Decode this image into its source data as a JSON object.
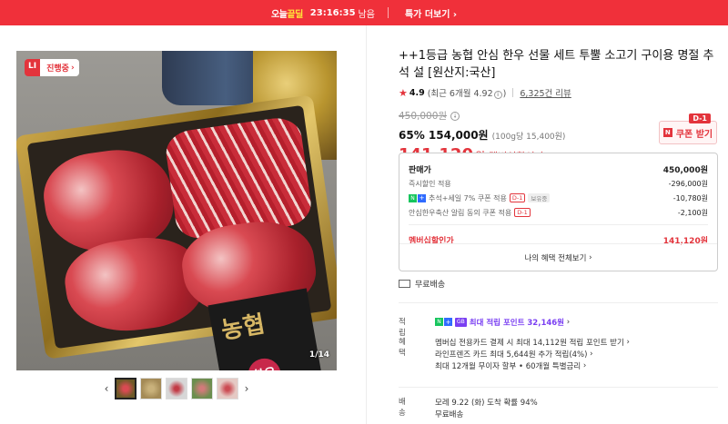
{
  "topbar": {
    "logo_prefix": "오늘",
    "logo_suffix": "끝딜",
    "timer": "23:16:35",
    "timer_suffix": "남음",
    "more_label": "특가 더보기",
    "color": "#f0303a"
  },
  "gallery": {
    "badge_live": "LI",
    "badge_label": "진행중",
    "counter": "1/14",
    "box_text": "농협",
    "box_text2": "한우",
    "thumb_count": 5
  },
  "product": {
    "title": "++1등급 농협 안심 한우 선물 세트 투뿔 소고기 구이용 명절 추석 설 [원산지:국산]",
    "rating_star": "★",
    "rating_score": "4.9",
    "rating_recent": "(최근 6개월 4.92",
    "rating_recent_close": ")",
    "review_count": "6,325건 리뷰",
    "original_price": "450,000원",
    "discount_price": "65% 154,000원",
    "unit_price": "(100g당 15,400원)",
    "member_price": "141,120",
    "member_won": "원",
    "member_label": "멤버십할인가"
  },
  "coupon": {
    "n": "N",
    "label": "쿠폰 받기",
    "d1": "D-1"
  },
  "breakdown": {
    "head_label": "판매가",
    "head_value": "450,000원",
    "rows": [
      {
        "label": "즉시할인 적용",
        "value": "-296,000원"
      },
      {
        "label": "추석+세일 7% 쿠폰 적용",
        "value": "-10,780원",
        "tag": "D-1",
        "extra": "보유중"
      },
      {
        "label": "안심한우축산 알림 동의 쿠폰 적용",
        "value": "-2,100원",
        "tag": "D-1"
      }
    ],
    "sale_label": "멤버십할인가",
    "sale_value": "141,120원",
    "all_benefits": "나의 혜택 전체보기"
  },
  "shipping": {
    "label": "무료배송"
  },
  "points": {
    "key": "적립",
    "tag": "GB",
    "text": "최대 적립 포인트 32,146원"
  },
  "benefits": {
    "key": "혜택",
    "lines": [
      "멤버십 전용카드 결제 시 최대 14,112원 적립 포인트 받기",
      "라인프렌즈 카드 최대 5,644원 추가 적립(4%)",
      "최대 12개월 무이자 할부 • 60개월 특별금리"
    ]
  },
  "delivery": {
    "key": "배송",
    "lines": [
      "모레 9.22 (화) 도착 확률 94%",
      "무료배송"
    ]
  }
}
